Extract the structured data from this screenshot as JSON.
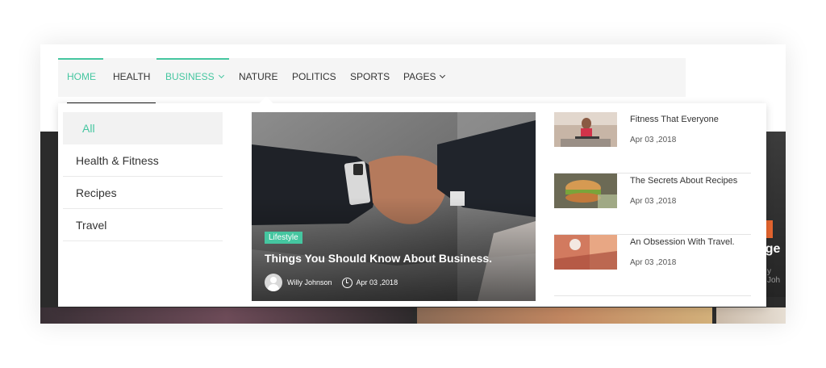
{
  "nav": {
    "items": [
      {
        "label": "HOME",
        "active": true,
        "dropdown": false
      },
      {
        "label": "HEALTH",
        "active": false,
        "dropdown": false
      },
      {
        "label": "BUSINESS",
        "active": true,
        "dropdown": true
      },
      {
        "label": "NATURE",
        "active": false,
        "dropdown": false
      },
      {
        "label": "POLITICS",
        "active": false,
        "dropdown": false
      },
      {
        "label": "SPORTS",
        "active": false,
        "dropdown": false
      },
      {
        "label": "PAGES",
        "active": false,
        "dropdown": true
      }
    ]
  },
  "mega_menu": {
    "categories": [
      {
        "label": "All",
        "active": true
      },
      {
        "label": "Health & Fitness",
        "active": false
      },
      {
        "label": "Recipes",
        "active": false
      },
      {
        "label": "Travel",
        "active": false
      }
    ],
    "featured": {
      "tag": "Lifestyle",
      "title": "Things You Should Know About Business.",
      "author": "Willy Johnson",
      "date": "Apr 03 ,2018"
    },
    "posts": [
      {
        "title": "Fitness That Everyone",
        "date": "Apr 03 ,2018"
      },
      {
        "title": "The Secrets About Recipes",
        "date": "Apr 03 ,2018"
      },
      {
        "title": "An Obsession With Travel.",
        "date": "Apr 03 ,2018"
      }
    ]
  },
  "background": {
    "partial_heading": "dge",
    "partial_byline": "y Joh"
  },
  "colors": {
    "accent": "#45c6a0",
    "text": "#333333",
    "nav_bg": "#f5f5f5"
  }
}
